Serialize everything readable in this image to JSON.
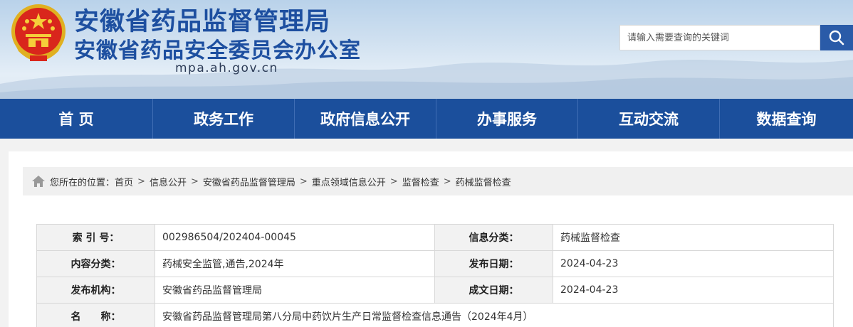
{
  "header": {
    "title_line1": "安徽省药品监督管理局",
    "title_line2": "安徽省药品安全委员会办公室",
    "domain": "mpa.ah.gov.cn",
    "search_placeholder": "请输入需要查询的关键词",
    "search_icon": "search-icon",
    "emblem": "national-emblem"
  },
  "nav": {
    "items": [
      "首 页",
      "政务工作",
      "政府信息公开",
      "办事服务",
      "互动交流",
      "数据查询"
    ]
  },
  "breadcrumb": {
    "prefix": "您所在的位置：",
    "items": [
      "首页",
      "信息公开",
      "安徽省药品监督管理局",
      "重点领域信息公开",
      "监督检查",
      "药械监督检查"
    ],
    "separator": ">",
    "icon": "home-icon"
  },
  "meta": {
    "rows": [
      {
        "label1": "索 引 号：",
        "value1": "002986504/202404-00045",
        "label2": "信息分类：",
        "value2": "药械监督检查"
      },
      {
        "label1": "内容分类：",
        "value1": "药械安全监管,通告,2024年",
        "label2": "发布日期：",
        "value2": "2024-04-23"
      },
      {
        "label1": "发布机构：",
        "value1": "安徽省药品监督管理局",
        "label2": "成文日期：",
        "value2": "2024-04-23"
      }
    ],
    "name_label": "名　　称：",
    "name_value": "安徽省药品监督管理局第八分局中药饮片生产日常监督检查信息通告（2024年4月）"
  },
  "colors": {
    "nav_bg": "#1b4f9c",
    "title_blue": "#1d4fa0",
    "search_btn": "#2a5ba8"
  }
}
